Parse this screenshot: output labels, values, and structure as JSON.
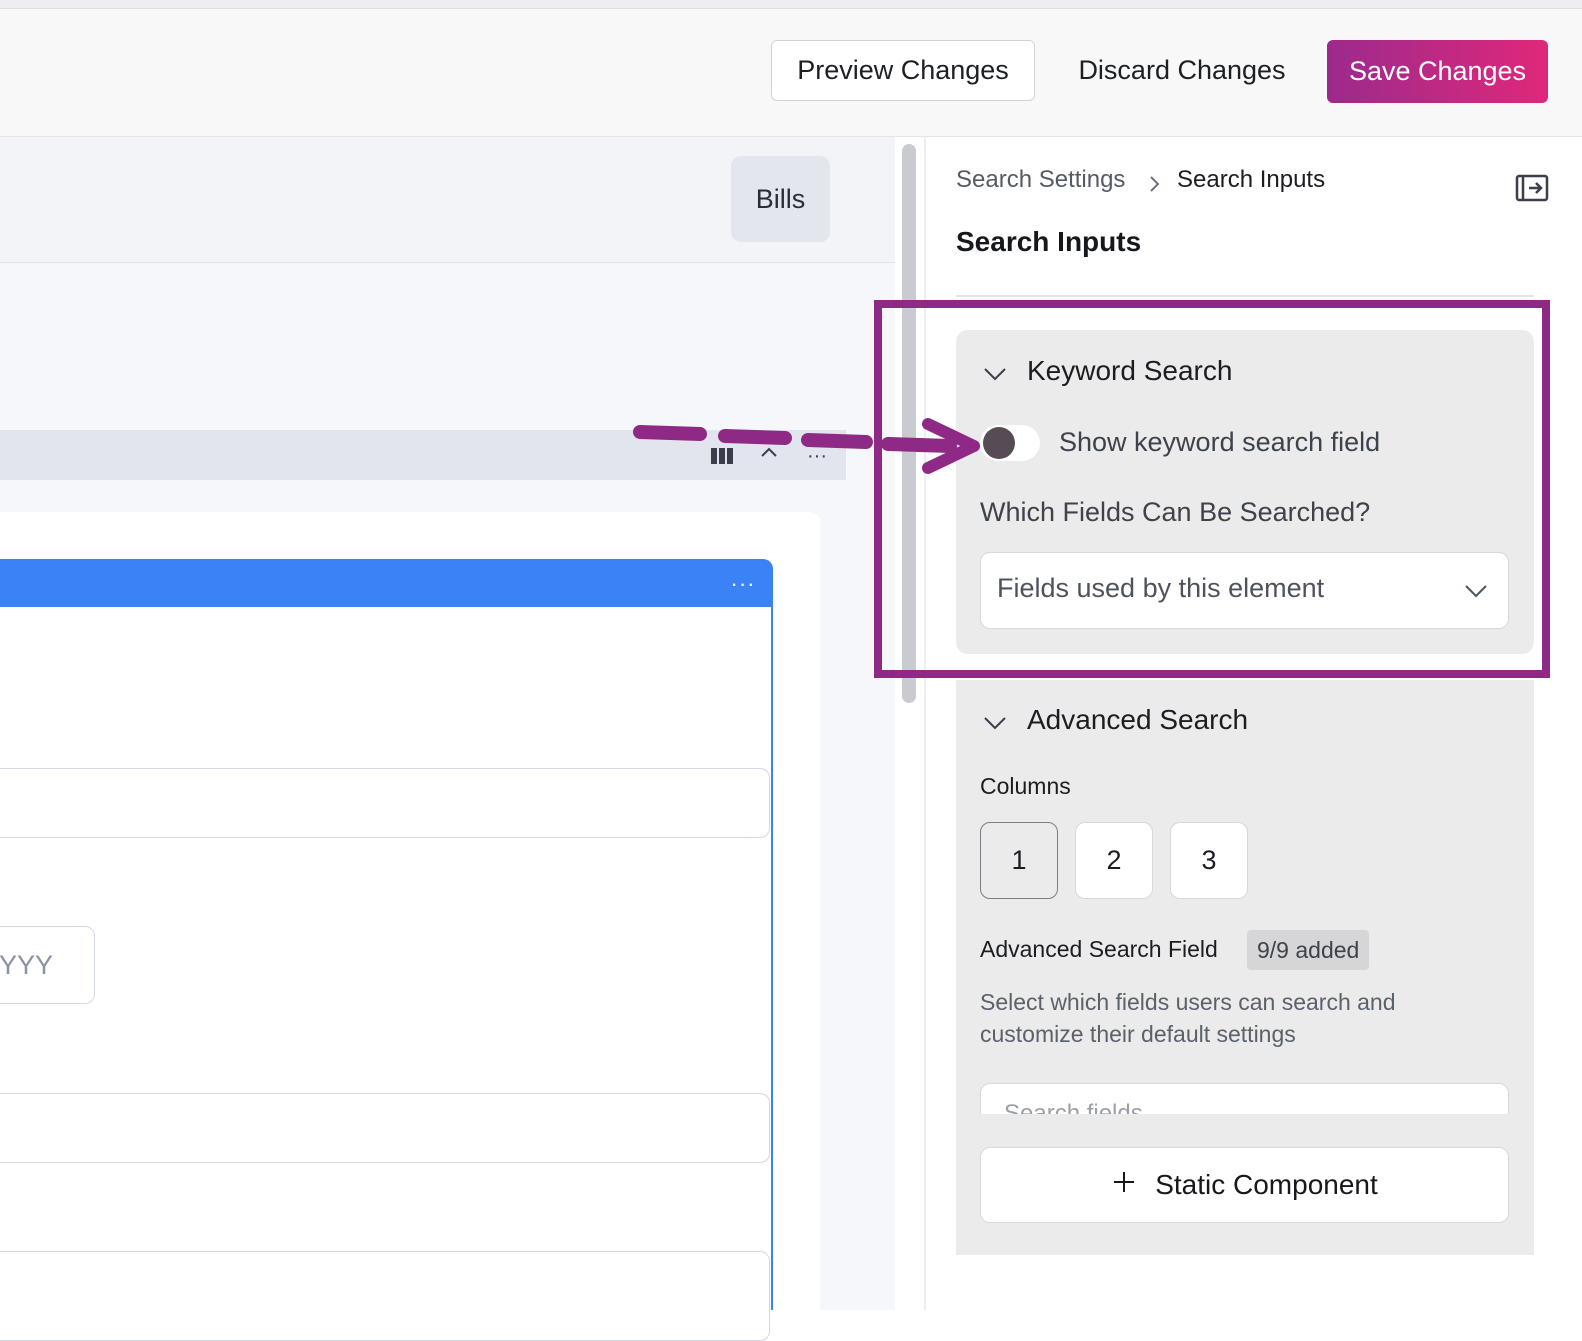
{
  "toolbar": {
    "preview_label": "Preview Changes",
    "discard_label": "Discard Changes",
    "save_label": "Save Changes"
  },
  "canvas": {
    "tab_label": "Bills",
    "date_placeholder": "YYY"
  },
  "panel": {
    "breadcrumb": [
      "Search Settings",
      "Search Inputs"
    ],
    "title": "Search Inputs",
    "keyword_search": {
      "title": "Keyword Search",
      "toggle_label": "Show keyword search field",
      "toggle_on": false,
      "fields_label": "Which Fields Can Be Searched?",
      "fields_value": "Fields used by this element"
    },
    "advanced_search": {
      "title": "Advanced Search",
      "columns_label": "Columns",
      "columns_options": [
        "1",
        "2",
        "3"
      ],
      "columns_selected": "1",
      "field_label": "Advanced Search Field",
      "field_badge": "9/9 added",
      "description": "Select which fields users can search and customize their default settings",
      "search_placeholder": "Search fields",
      "static_button_label": "Static Component"
    }
  },
  "colors": {
    "accent_start": "#9b2a8c",
    "accent_end": "#e0287a",
    "annotation": "#8e2a86",
    "canvas_blue": "#3b82f6"
  }
}
